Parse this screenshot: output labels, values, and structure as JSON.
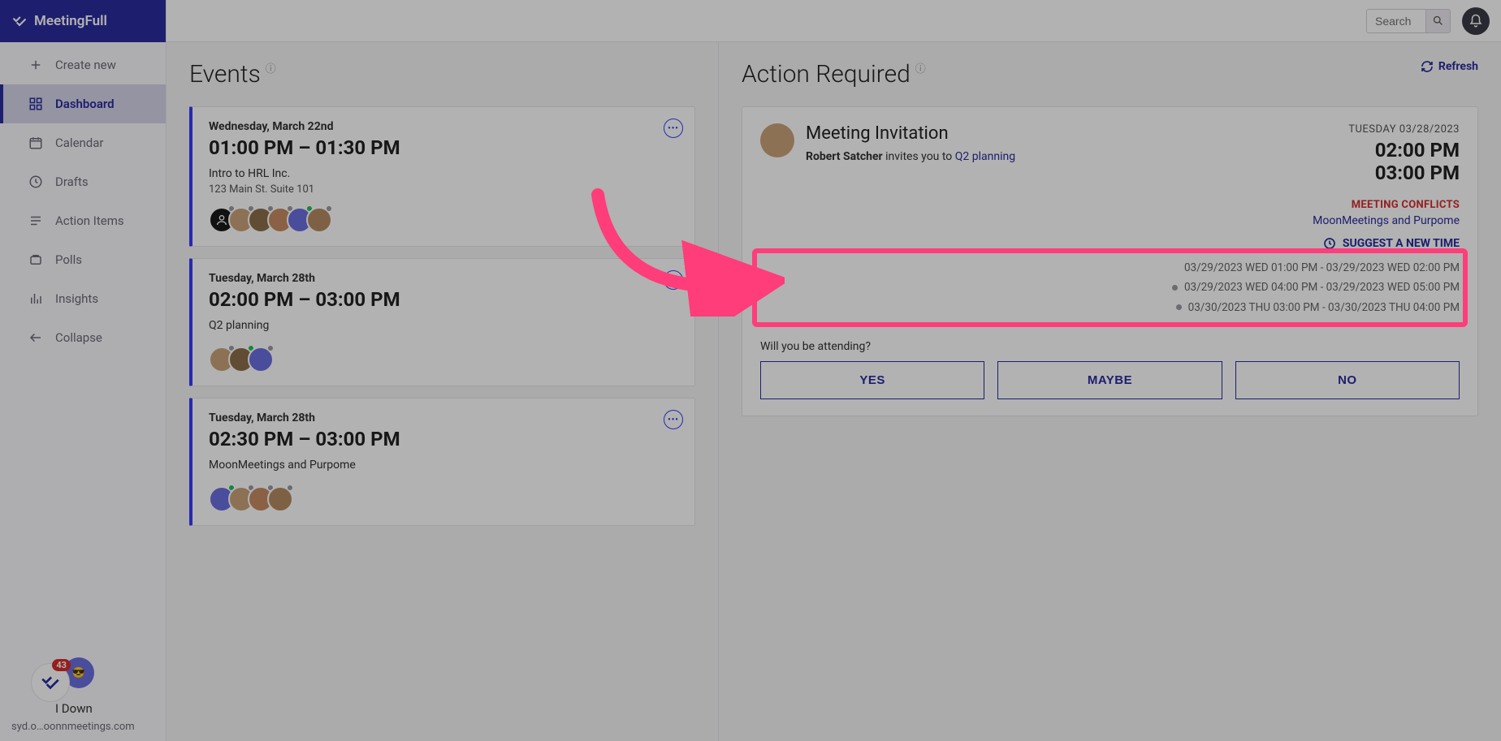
{
  "brand": {
    "name": "MeetingFull"
  },
  "search": {
    "placeholder": "Search"
  },
  "nav": {
    "create": "Create new",
    "items": [
      {
        "label": "Dashboard",
        "active": true
      },
      {
        "label": "Calendar"
      },
      {
        "label": "Drafts"
      },
      {
        "label": "Action Items"
      },
      {
        "label": "Polls"
      },
      {
        "label": "Insights"
      },
      {
        "label": "Collapse"
      }
    ]
  },
  "user": {
    "name": "I Down",
    "email": "syd.o…oonnmeetings.com",
    "notif_count": "43"
  },
  "events": {
    "title": "Events",
    "items": [
      {
        "date": "Wednesday, March 22nd",
        "time": "01:00 PM – 01:30 PM",
        "title": "Intro to HRL Inc.",
        "location": "123 Main St. Suite 101",
        "avatars": 6
      },
      {
        "date": "Tuesday, March 28th",
        "time": "02:00 PM – 03:00 PM",
        "title": "Q2 planning",
        "location": "",
        "avatars": 3
      },
      {
        "date": "Tuesday, March 28th",
        "time": "02:30 PM – 03:00 PM",
        "title": "MoonMeetings and Purpome",
        "location": "",
        "avatars": 4
      }
    ]
  },
  "action": {
    "title": "Action Required",
    "refresh": "Refresh",
    "heading": "Meeting Invitation",
    "inviter": "Robert Satcher",
    "invites_text": " invites you to ",
    "meeting_link": "Q2 planning",
    "date": "TUESDAY 03/28/2023",
    "time_start": "02:00 PM",
    "time_end": "03:00 PM",
    "conflicts_label": "MEETING CONFLICTS",
    "conflicts_link": "MoonMeetings and Purpome",
    "suggest_label": "SUGGEST A NEW TIME",
    "suggestions": [
      "03/29/2023 WED 01:00 PM - 03/29/2023 WED 02:00 PM",
      "03/29/2023 WED 04:00 PM - 03/29/2023 WED 05:00 PM",
      "03/30/2023 THU 03:00 PM - 03/30/2023 THU 04:00 PM"
    ],
    "attend_q": "Will you be attending?",
    "rsvp": {
      "yes": "YES",
      "maybe": "MAYBE",
      "no": "NO"
    }
  }
}
